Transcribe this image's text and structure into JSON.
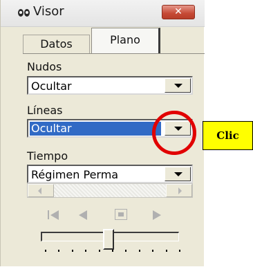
{
  "window": {
    "title": "Visor",
    "close_label": "✕",
    "icon": "binoculars-icon"
  },
  "tabs": [
    {
      "label": "Datos",
      "active": false
    },
    {
      "label": "Plano",
      "active": true
    }
  ],
  "fields": {
    "nudos": {
      "label": "Nudos",
      "value": "Ocultar"
    },
    "lineas": {
      "label": "Líneas",
      "value": "Ocultar",
      "selected": true
    },
    "tiempo": {
      "label": "Tiempo",
      "value": "Régimen Perma"
    }
  },
  "playback": {
    "buttons": [
      "first-frame-icon",
      "step-back-icon",
      "stop-icon",
      "play-icon"
    ],
    "enabled": false
  },
  "slider": {
    "ticks": 11
  },
  "annotation": {
    "callout_text": "Clic",
    "ring_color": "#e10000",
    "callout_color": "#ffff00"
  }
}
